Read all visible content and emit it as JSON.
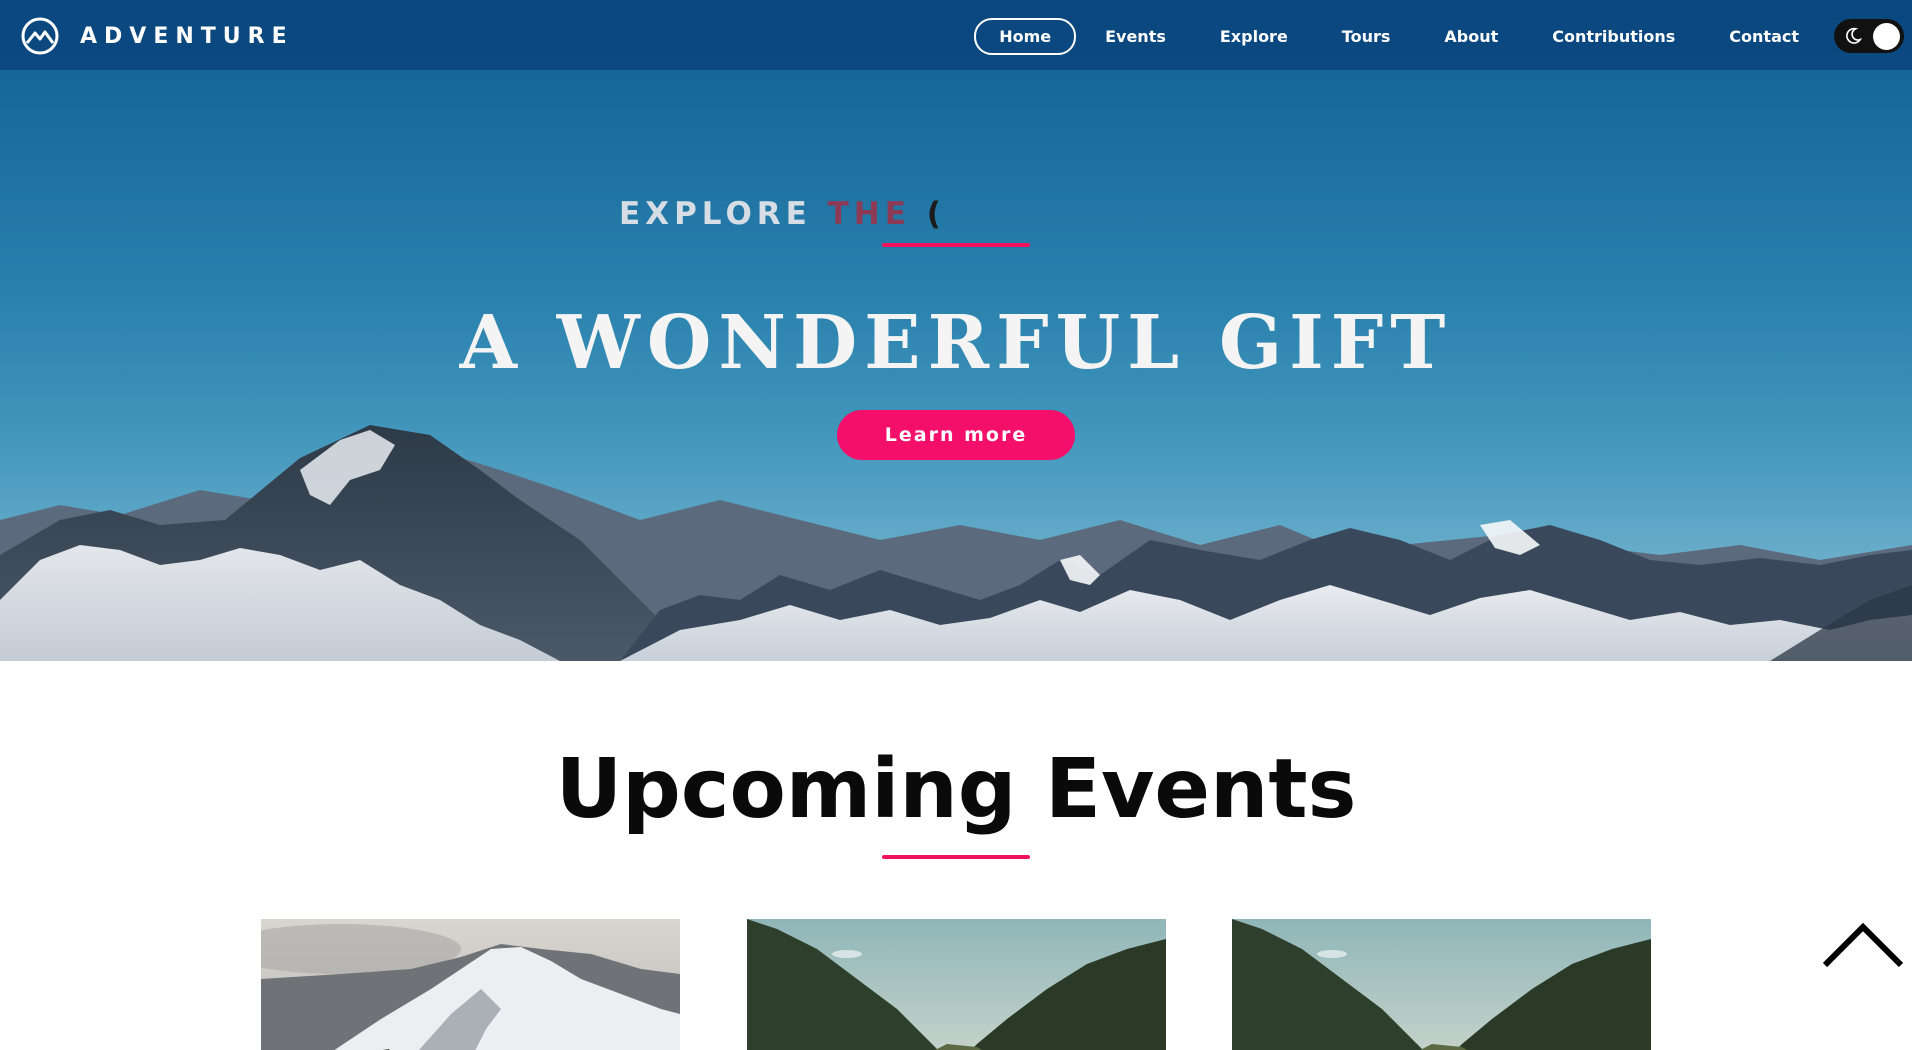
{
  "brand": {
    "name": "ADVENTURE",
    "logo_icon": "mountain-logo-icon"
  },
  "nav": {
    "items": [
      {
        "label": "Home",
        "active": true
      },
      {
        "label": "Events",
        "active": false
      },
      {
        "label": "Explore",
        "active": false
      },
      {
        "label": "Tours",
        "active": false
      },
      {
        "label": "About",
        "active": false
      },
      {
        "label": "Contributions",
        "active": false
      },
      {
        "label": "Contact",
        "active": false
      }
    ],
    "theme_toggle_icon": "moon-icon"
  },
  "hero": {
    "kicker": [
      "EXPLORE",
      "THE",
      "("
    ],
    "title": "A WONDERFUL GIFT",
    "button_label": "Learn more",
    "accent_color": "#f4106a"
  },
  "events": {
    "title": "Upcoming Events",
    "cards": [
      {
        "image": "snowy-mountain-peak-image"
      },
      {
        "image": "green-valley-image"
      },
      {
        "image": "green-valley-image"
      }
    ]
  },
  "scroll_top_icon": "chevron-up-icon"
}
